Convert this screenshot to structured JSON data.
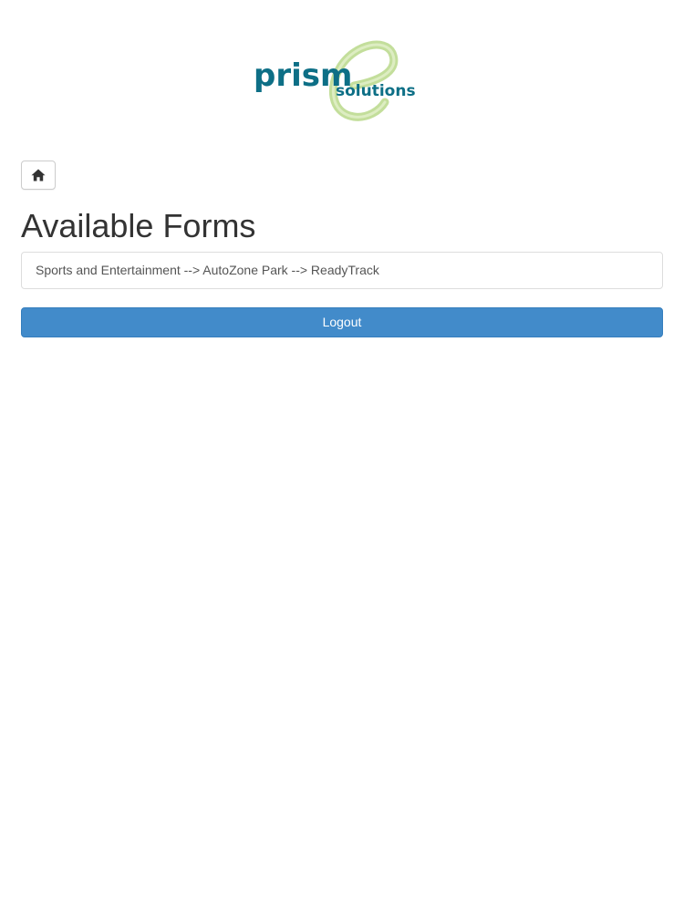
{
  "logo": {
    "text_main": "prism",
    "text_sub": "solutions",
    "script_letter": "e",
    "colors": {
      "text": "#0d6f86",
      "swirl": "#b9d98a"
    }
  },
  "nav": {
    "home_icon": "home-icon"
  },
  "main": {
    "title": "Available Forms",
    "forms": [
      {
        "label": "Sports and Entertainment --> AutoZone Park --> ReadyTrack"
      }
    ],
    "logout_label": "Logout"
  },
  "colors": {
    "primary": "#428bca",
    "text": "#333333",
    "border": "#dddddd"
  }
}
